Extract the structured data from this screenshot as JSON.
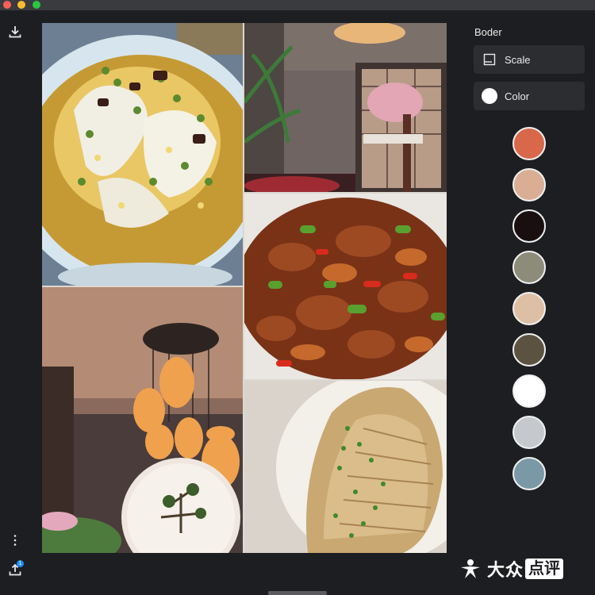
{
  "panel": {
    "title": "Boder",
    "options": [
      {
        "label": "Scale",
        "icon": "square-frame-icon"
      },
      {
        "label": "Color",
        "icon": "white-circle-icon"
      }
    ],
    "swatches": [
      "#d9684a",
      "#d9ae95",
      "#1a0f10",
      "#8d8c7a",
      "#dcbfa5",
      "#5b5240",
      "#ffffff",
      "#c5c9ce",
      "#7a98a6"
    ]
  },
  "toolbar": {
    "download_icon": "download-icon",
    "more_icon": "more-vertical-icon",
    "share_icon": "share-icon",
    "share_badge": "1"
  },
  "photos": [
    {
      "name": "photo-soup-bowl"
    },
    {
      "name": "photo-restaurant-entrance"
    },
    {
      "name": "photo-spicy-stir-fry"
    },
    {
      "name": "photo-lantern-interior"
    },
    {
      "name": "photo-steamed-fish"
    }
  ],
  "watermark": {
    "text_a": "大众",
    "text_b": "点评"
  },
  "colors": {
    "background": "#1d1e21",
    "button": "#2c2d31"
  }
}
